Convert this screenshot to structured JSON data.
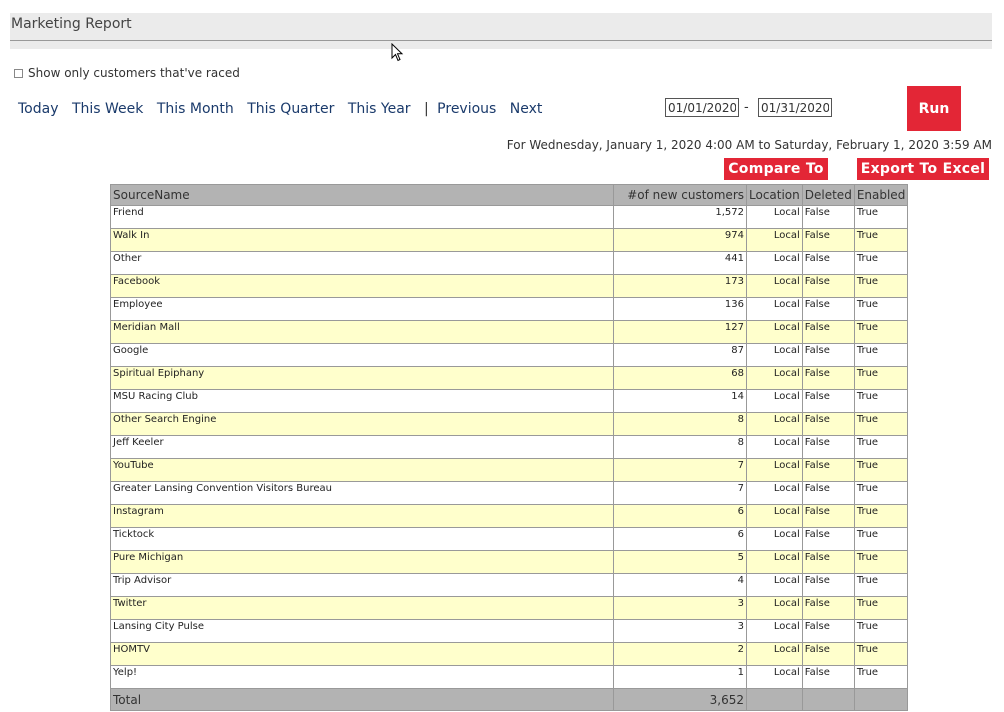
{
  "header": {
    "title": "Marketing Report"
  },
  "filter": {
    "raced_label": "Show only customers that've raced"
  },
  "range_nav": {
    "today": "Today",
    "this_week": "This Week",
    "this_month": "This Month",
    "this_quarter": "This Quarter",
    "this_year": "This Year",
    "separator": "|",
    "previous": "Previous",
    "next": "Next"
  },
  "dates": {
    "start": "01/01/2020",
    "separator": "-",
    "end": "01/31/2020"
  },
  "run_label": "Run",
  "period_text": "For Wednesday, January 1, 2020 4:00 AM to Saturday, February 1, 2020 3:59 AM",
  "compare_label": "Compare To",
  "export_label": "Export To Excel",
  "table": {
    "columns": [
      "SourceName",
      "#of new customers",
      "Location",
      "Deleted",
      "Enabled"
    ],
    "rows": [
      [
        "Friend",
        "1,572",
        "Local",
        "False",
        "True"
      ],
      [
        "Walk In",
        "974",
        "Local",
        "False",
        "True"
      ],
      [
        "Other",
        "441",
        "Local",
        "False",
        "True"
      ],
      [
        "Facebook",
        "173",
        "Local",
        "False",
        "True"
      ],
      [
        "Employee",
        "136",
        "Local",
        "False",
        "True"
      ],
      [
        "Meridian Mall",
        "127",
        "Local",
        "False",
        "True"
      ],
      [
        "Google",
        "87",
        "Local",
        "False",
        "True"
      ],
      [
        "Spiritual Epiphany",
        "68",
        "Local",
        "False",
        "True"
      ],
      [
        "MSU Racing Club",
        "14",
        "Local",
        "False",
        "True"
      ],
      [
        "Other Search Engine",
        "8",
        "Local",
        "False",
        "True"
      ],
      [
        "Jeff Keeler",
        "8",
        "Local",
        "False",
        "True"
      ],
      [
        "YouTube",
        "7",
        "Local",
        "False",
        "True"
      ],
      [
        "Greater Lansing Convention Visitors Bureau",
        "7",
        "Local",
        "False",
        "True"
      ],
      [
        "Instagram",
        "6",
        "Local",
        "False",
        "True"
      ],
      [
        "Ticktock",
        "6",
        "Local",
        "False",
        "True"
      ],
      [
        "Pure Michigan",
        "5",
        "Local",
        "False",
        "True"
      ],
      [
        "Trip Advisor",
        "4",
        "Local",
        "False",
        "True"
      ],
      [
        "Twitter",
        "3",
        "Local",
        "False",
        "True"
      ],
      [
        "Lansing City Pulse",
        "3",
        "Local",
        "False",
        "True"
      ],
      [
        "HOMTV",
        "2",
        "Local",
        "False",
        "True"
      ],
      [
        "Yelp!",
        "1",
        "Local",
        "False",
        "True"
      ]
    ],
    "total_label": "Total",
    "total_value": "3,652"
  }
}
